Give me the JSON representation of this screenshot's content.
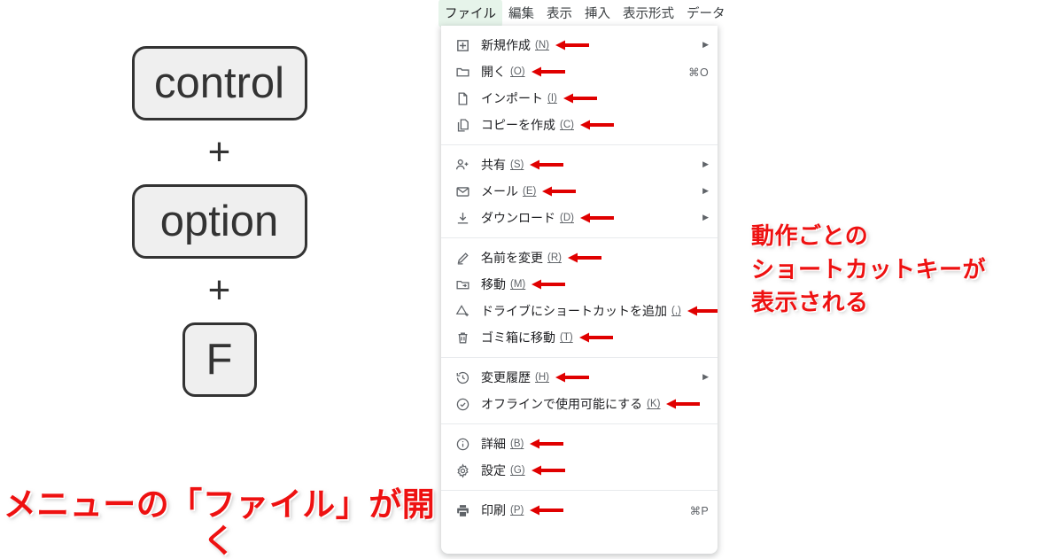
{
  "keycombo": {
    "keys": [
      "control",
      "option",
      "F"
    ],
    "separator": "+",
    "caption": "メニューの「ファイル」が開く"
  },
  "menubar": {
    "items": [
      {
        "label": "ファイル",
        "active": true
      },
      {
        "label": "編集",
        "active": false
      },
      {
        "label": "表示",
        "active": false
      },
      {
        "label": "挿入",
        "active": false
      },
      {
        "label": "表示形式",
        "active": false
      },
      {
        "label": "データ",
        "active": false
      }
    ],
    "active_highlight_color": "#e6f4ea"
  },
  "menu": {
    "sections": [
      {
        "items": [
          {
            "icon": "new-file-icon",
            "label": "新規作成",
            "mnemonic": "(N)",
            "red_arrow": true,
            "submenu": true,
            "shortcut": ""
          },
          {
            "icon": "folder-open-icon",
            "label": "開く",
            "mnemonic": "(O)",
            "red_arrow": true,
            "submenu": false,
            "shortcut": "⌘O"
          },
          {
            "icon": "import-file-icon",
            "label": "インポート",
            "mnemonic": "(I)",
            "red_arrow": true,
            "submenu": false,
            "shortcut": ""
          },
          {
            "icon": "make-copy-icon",
            "label": "コピーを作成",
            "mnemonic": "(C)",
            "red_arrow": true,
            "submenu": false,
            "shortcut": ""
          }
        ]
      },
      {
        "items": [
          {
            "icon": "person-add-icon",
            "label": "共有",
            "mnemonic": "(S)",
            "red_arrow": true,
            "submenu": true,
            "shortcut": ""
          },
          {
            "icon": "mail-icon",
            "label": "メール",
            "mnemonic": "(E)",
            "red_arrow": true,
            "submenu": true,
            "shortcut": ""
          },
          {
            "icon": "download-icon",
            "label": "ダウンロード",
            "mnemonic": "(D)",
            "red_arrow": true,
            "submenu": true,
            "shortcut": ""
          }
        ]
      },
      {
        "items": [
          {
            "icon": "rename-pencil-icon",
            "label": "名前を変更",
            "mnemonic": "(R)",
            "red_arrow": true,
            "submenu": false,
            "shortcut": ""
          },
          {
            "icon": "move-folder-icon",
            "label": "移動",
            "mnemonic": "(M)",
            "red_arrow": true,
            "submenu": false,
            "shortcut": ""
          },
          {
            "icon": "drive-shortcut-add-icon",
            "label": "ドライブにショートカットを追加",
            "mnemonic": "(,)",
            "red_arrow": true,
            "submenu": false,
            "shortcut": ""
          },
          {
            "icon": "trash-icon",
            "label": "ゴミ箱に移動",
            "mnemonic": "(T)",
            "red_arrow": true,
            "submenu": false,
            "shortcut": ""
          }
        ]
      },
      {
        "items": [
          {
            "icon": "version-history-icon",
            "label": "変更履歴",
            "mnemonic": "(H)",
            "red_arrow": true,
            "submenu": true,
            "shortcut": ""
          },
          {
            "icon": "offline-check-icon",
            "label": "オフラインで使用可能にする",
            "mnemonic": "(K)",
            "red_arrow": true,
            "submenu": false,
            "shortcut": ""
          }
        ]
      },
      {
        "items": [
          {
            "icon": "info-icon",
            "label": "詳細",
            "mnemonic": "(B)",
            "red_arrow": true,
            "submenu": false,
            "shortcut": ""
          },
          {
            "icon": "gear-icon",
            "label": "設定",
            "mnemonic": "(G)",
            "red_arrow": true,
            "submenu": false,
            "shortcut": ""
          }
        ]
      },
      {
        "items": [
          {
            "icon": "print-icon",
            "label": "印刷",
            "mnemonic": "(P)",
            "red_arrow": true,
            "submenu": false,
            "shortcut": "⌘P"
          }
        ]
      }
    ]
  },
  "right_caption": {
    "lines": [
      "動作ごとの",
      "ショートカットキーが",
      "表示される"
    ]
  },
  "colors": {
    "accent_red": "#ee1111",
    "menu_text": "#202124",
    "icon_gray": "#5f6368",
    "divider": "#e8eaed",
    "keycap_fill": "#efefef",
    "keycap_border": "#333333"
  }
}
